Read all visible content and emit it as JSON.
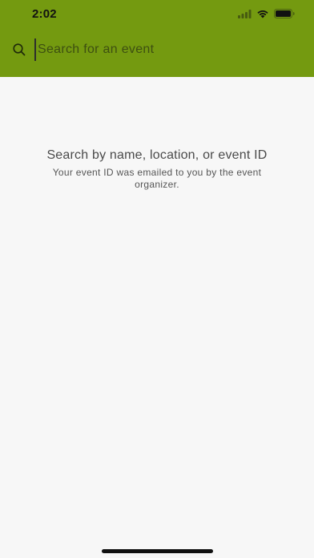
{
  "status_bar": {
    "time": "2:02",
    "icons": [
      "cellular-signal-icon",
      "wifi-icon",
      "battery-icon"
    ]
  },
  "search": {
    "icon": "search-icon",
    "placeholder": "Search for an event",
    "value": ""
  },
  "empty_state": {
    "title": "Search by name, location, or event ID",
    "subtitle": "Your event ID was emailed to you by the event organizer."
  },
  "colors": {
    "header_background": "#749a10",
    "page_background": "#f7f7f7",
    "title_text": "#4a4a4a",
    "subtitle_text": "#555555"
  }
}
